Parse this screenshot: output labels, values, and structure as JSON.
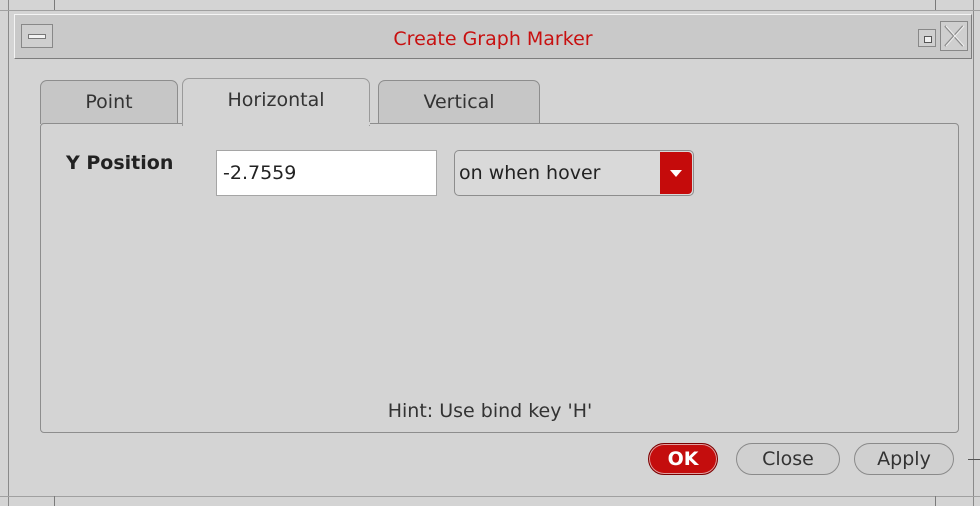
{
  "window": {
    "title": "Create Graph Marker"
  },
  "tabs": [
    {
      "label": "Point",
      "active": false
    },
    {
      "label": "Horizontal",
      "active": true
    },
    {
      "label": "Vertical",
      "active": false
    }
  ],
  "form": {
    "y_position_label": "Y Position",
    "y_position_value": "-2.7559",
    "display_mode_selected": "on when hover",
    "hint": "Hint: Use bind key 'H'"
  },
  "buttons": {
    "ok": "OK",
    "close": "Close",
    "apply": "Apply"
  },
  "colors": {
    "title_text": "#c81010",
    "accent_red": "#c40d0d",
    "background": "#d4d4d4"
  },
  "icons": {
    "window_menu": "window-menu-icon",
    "minimize": "minimize-icon",
    "close": "close-x-icon",
    "dropdown": "dropdown-arrow-icon"
  }
}
